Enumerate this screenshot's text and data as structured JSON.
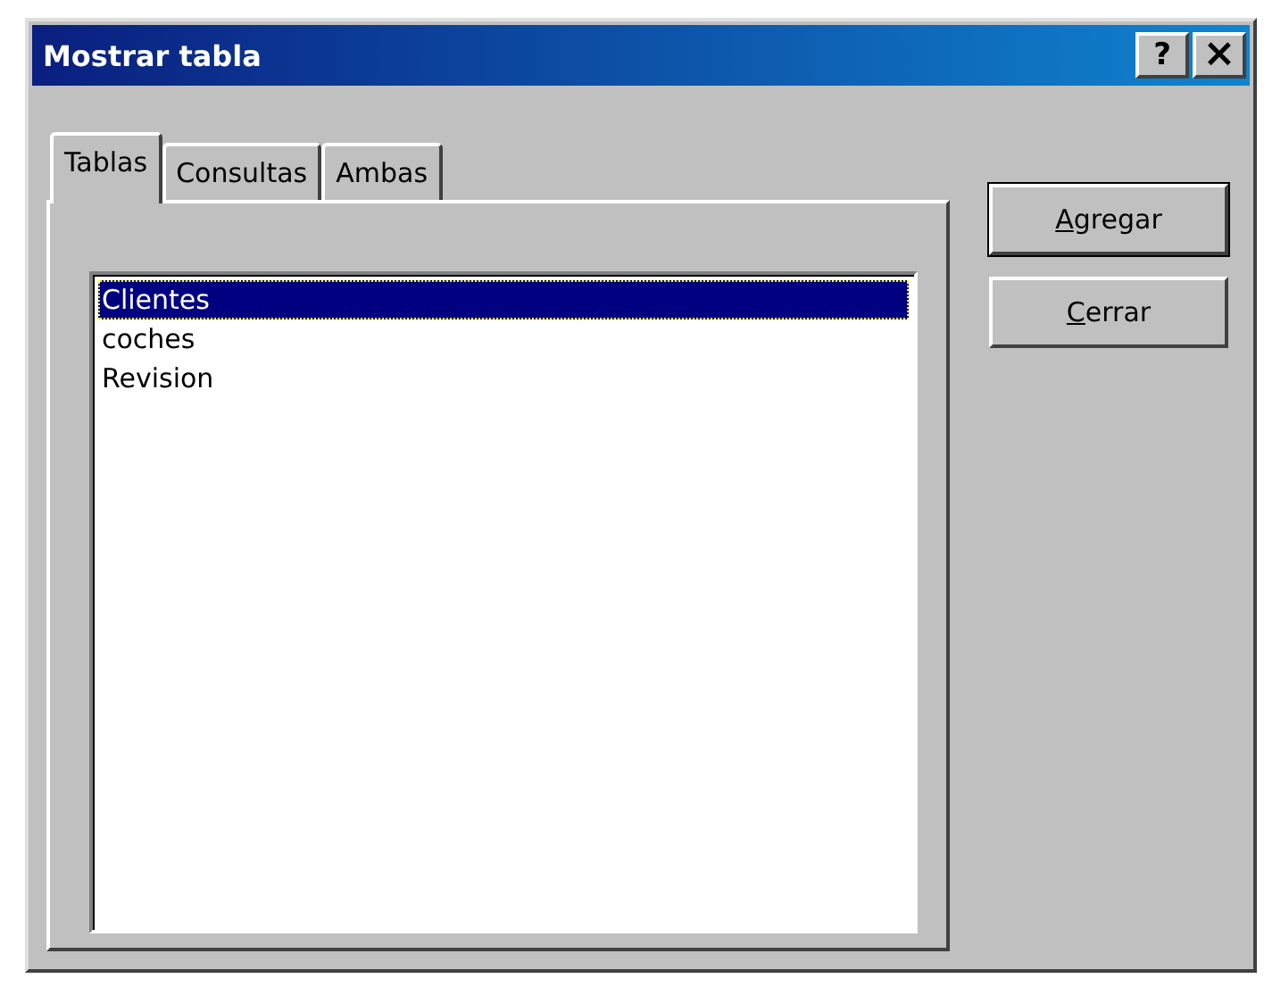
{
  "window": {
    "title": "Mostrar tabla",
    "title_buttons": [
      {
        "label": "?",
        "kind": "help"
      },
      {
        "label": "×",
        "kind": "close"
      }
    ]
  },
  "tabs": [
    {
      "label": "Tablas",
      "selected": true
    },
    {
      "label": "Consultas",
      "selected": false
    },
    {
      "label": "Ambas",
      "selected": false
    }
  ],
  "list": [
    {
      "label": "Clientes",
      "selected": true
    },
    {
      "label": "coches",
      "selected": false
    },
    {
      "label": "Revision",
      "selected": false
    }
  ],
  "buttons": [
    {
      "label": "Agregar",
      "mnemonic": true,
      "default": true
    },
    {
      "label": "Cerrar",
      "mnemonic": true,
      "default": false
    }
  ]
}
